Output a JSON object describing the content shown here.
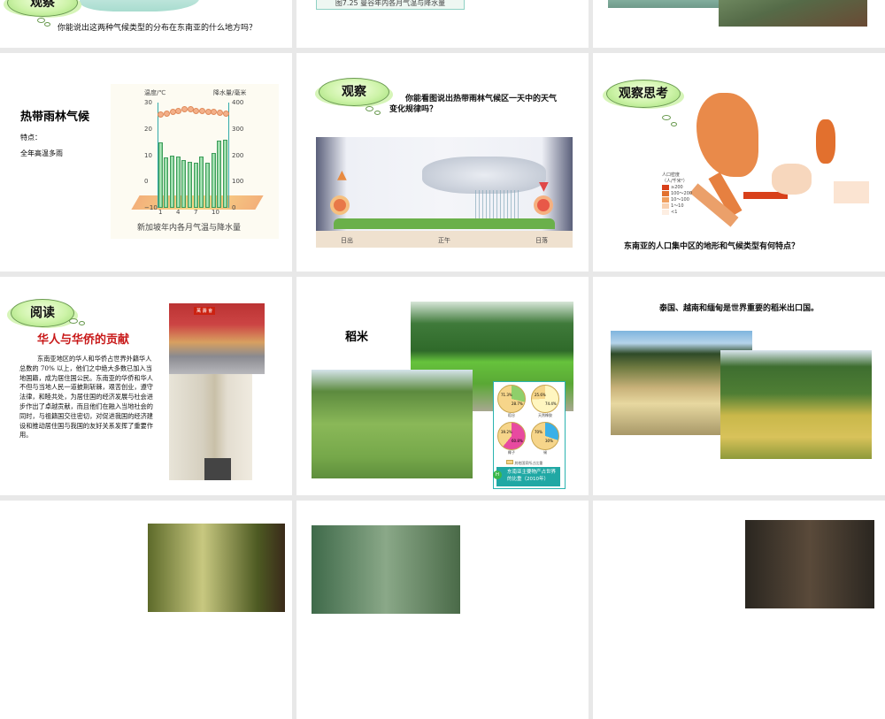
{
  "slides_row1": {
    "left": {
      "badge": "观察",
      "question": "你能说出这两种气候类型的分布在东南亚的什么地方吗？"
    },
    "middle": {
      "caption": "图7.25   曼谷年内各月气温与降水量"
    }
  },
  "slide_rainforest": {
    "title": "热带雨林气候",
    "feature_label": "特点：",
    "feature": "全年高温多雨",
    "chart_data": {
      "type": "bar",
      "title": "新加坡年内各月气温与降水量",
      "ylabel_left": "温度/℃",
      "ylabel_right": "降水量/毫米",
      "left_ticks": [
        "30",
        "20",
        "10",
        "0",
        "−10"
      ],
      "right_ticks": [
        "400",
        "300",
        "200",
        "100",
        "0"
      ],
      "x_ticks": [
        "1",
        "4",
        "7",
        "10"
      ],
      "ylim_temp": [
        -10,
        30
      ],
      "ylim_precip": [
        0,
        400
      ],
      "months": [
        1,
        2,
        3,
        4,
        5,
        6,
        7,
        8,
        9,
        10,
        11,
        12
      ],
      "temperature": [
        25.5,
        26,
        26.5,
        27,
        27.5,
        27.5,
        27,
        27,
        26.8,
        26.7,
        26.4,
        26
      ],
      "precipitation": [
        250,
        190,
        200,
        195,
        180,
        175,
        170,
        195,
        170,
        210,
        255,
        260
      ]
    }
  },
  "slide_weather": {
    "badge": "观察",
    "question": "你能看图说出热带雨林气候区一天中的天气变化规律吗？",
    "labels": [
      "日出",
      "正午",
      "日落"
    ]
  },
  "slide_population": {
    "badge": "观察思考",
    "legend_title": "人口密度",
    "legend_unit": "（人/千米²）",
    "legend": [
      {
        "label": "≥200",
        "color": "#d8401a"
      },
      {
        "label": "100～200",
        "color": "#e2702e"
      },
      {
        "label": "10～100",
        "color": "#f0a060"
      },
      {
        "label": "1～10",
        "color": "#f8d0b0"
      },
      {
        "label": "<1",
        "color": "#fdeee2"
      }
    ],
    "question": "东南亚的人口集中区的地形和气候类型有何特点？"
  },
  "slide_chinese": {
    "badge": "阅读",
    "title": "华人与华侨的贡献",
    "body": "东南亚地区的华人和华侨占世界外籍华人总数的 70% 以上，他们之中绝大多数已加入当地国籍，成为居住国公民。东南亚的华侨和华人不但与当地人民一道披荆斩棘，艰苦创业，遵守法律，和睦共处，为居住国的经济发展与社会进步作出了卓越贡献，而且他们在融入当地社会的同时，与祖籍国交往密切，对促进我国的经济建设和推动居住国与我国的友好关系发挥了重要作用。",
    "sign_text": "萬 壽 會"
  },
  "slide_rice": {
    "title": "稻米",
    "infographic": {
      "badge": "H",
      "caption": "东南亚主要物产占世界的比重（2010年）",
      "legend": "其他国家所占比重",
      "pies": [
        {
          "name": "稻谷",
          "other": "71.3%",
          "sea": "28.7%"
        },
        {
          "name": "天然橡胶",
          "other": "25.6%",
          "sea": "74.4%"
        },
        {
          "name": "椰子",
          "other": "39.2%",
          "sea": "60.8%"
        },
        {
          "name": "锡",
          "other": "70%",
          "sea": "30%"
        }
      ],
      "sea_label": "东南亚"
    }
  },
  "slide_export": {
    "text": "泰国、越南和缅甸是世界重要的稻米出口国。"
  }
}
